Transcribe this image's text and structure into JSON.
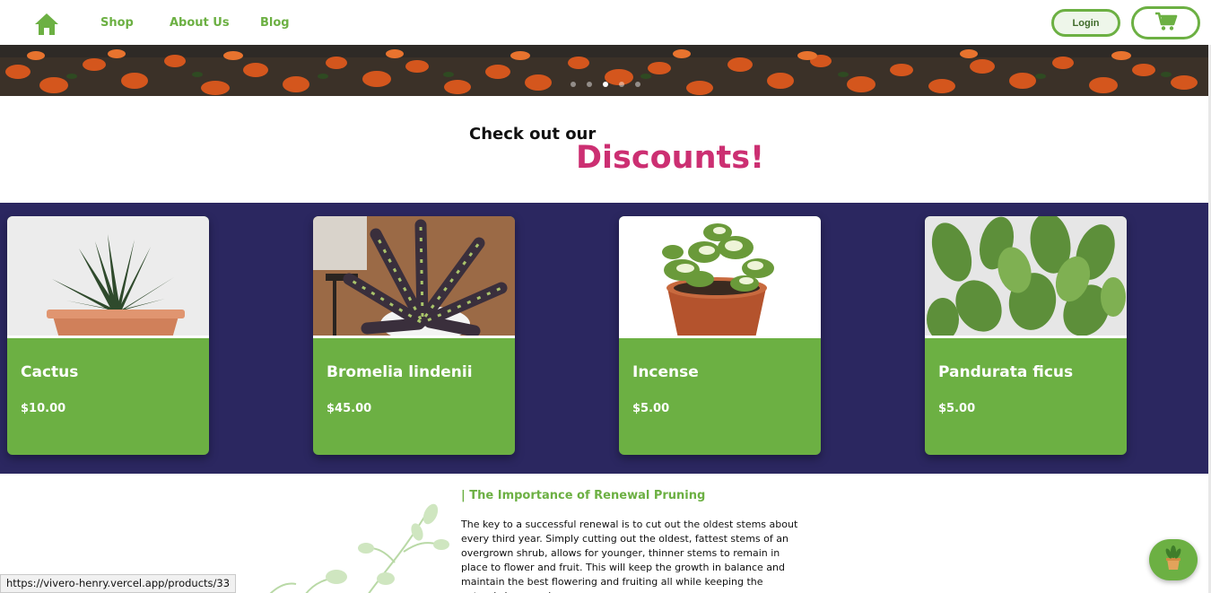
{
  "nav": {
    "home_icon": "home-icon",
    "links": [
      "Shop",
      "About Us",
      "Blog"
    ],
    "login_label": "Login",
    "cart_icon": "cart-icon",
    "accent_color": "#6cb043"
  },
  "banner": {
    "slide_count": 5,
    "active_slide": 3
  },
  "discounts": {
    "intro": "Check out our",
    "title": "Discounts!",
    "title_color": "#cc2f72",
    "band_color": "#2b2760"
  },
  "products": [
    {
      "name": "Cactus",
      "price": "$10.00"
    },
    {
      "name": "Bromelia lindenii",
      "price": "$45.00"
    },
    {
      "name": "Incense",
      "price": "$5.00"
    },
    {
      "name": "Pandurata ficus",
      "price": "$5.00"
    }
  ],
  "article": {
    "title": "| The Importance of Renewal Pruning",
    "body": "The key to a successful renewal is to cut out the oldest stems about every third year. Simply cutting out the oldest, fattest stems of an overgrown shrub, allows for younger, thinner stems to remain in place to flower and fruit. This will keep the growth in balance and maintain the best flowering and fruiting all while keeping the natural shape and"
  },
  "status_url": "https://vivero-henry.vercel.app/products/33",
  "fab_icon": "potted-plant-icon"
}
